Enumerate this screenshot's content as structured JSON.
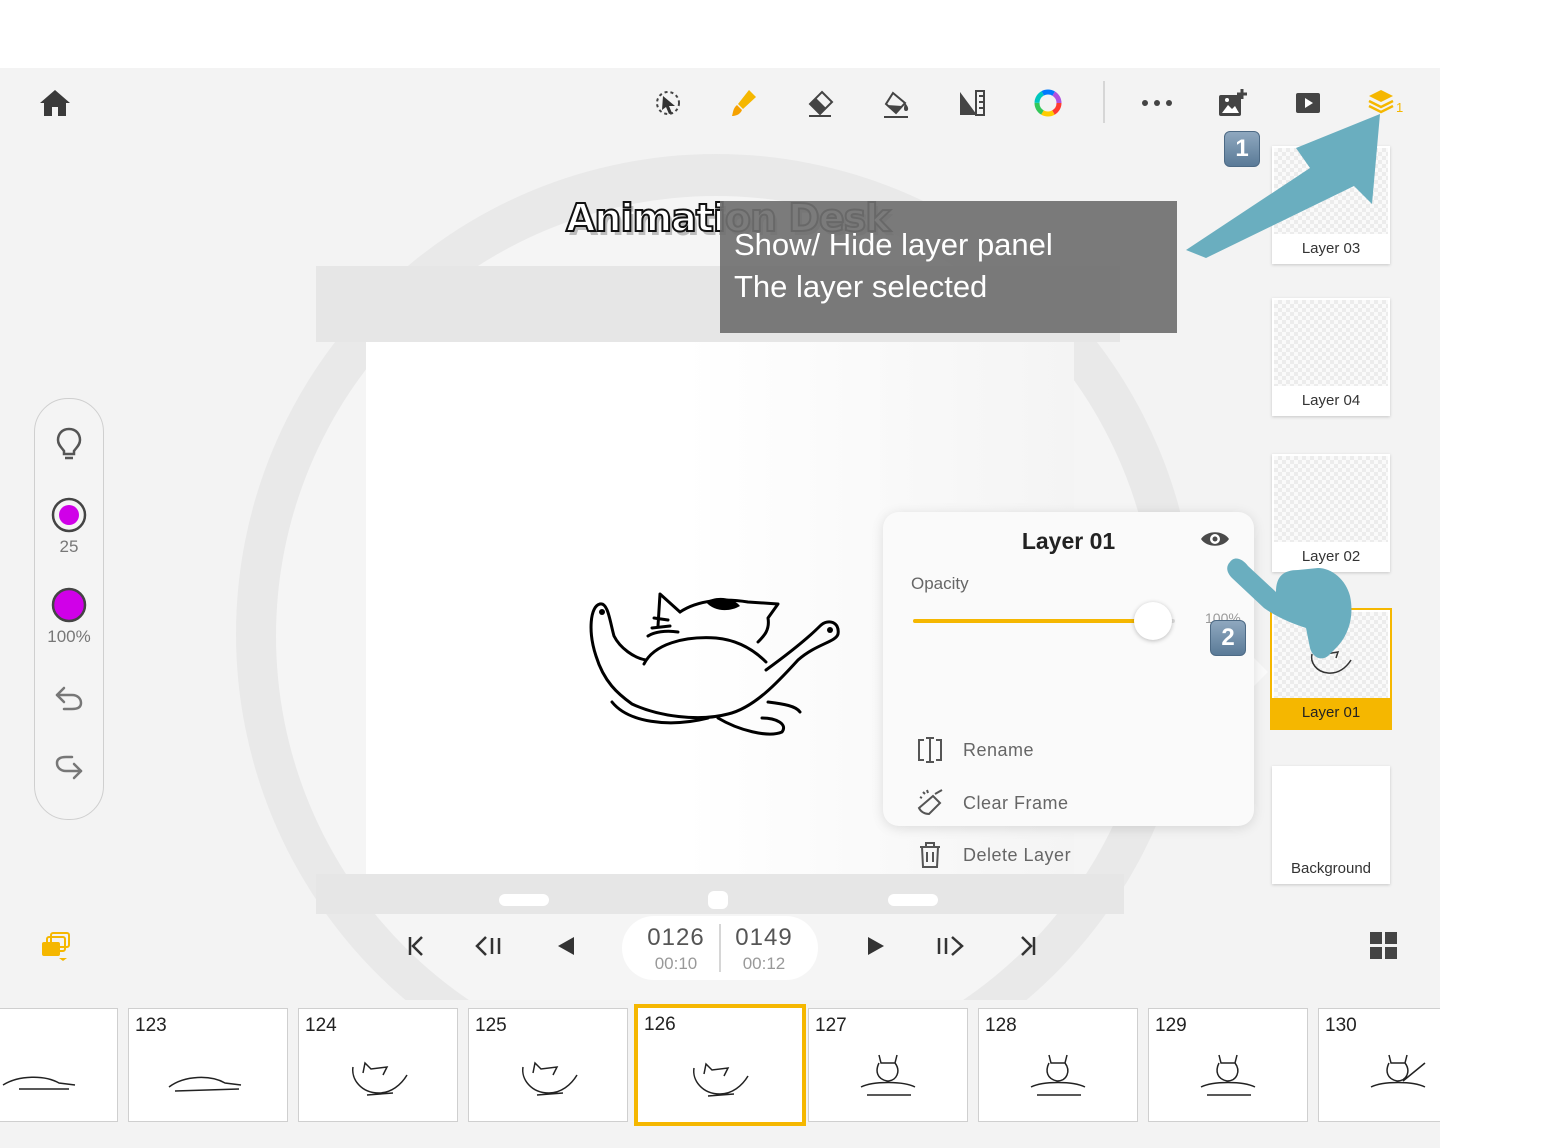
{
  "toolbar": {
    "tools": [
      "lasso-select-icon",
      "brush-icon",
      "eraser-icon",
      "paint-bucket-icon",
      "ruler-icon",
      "color-wheel-icon"
    ],
    "right": [
      "more-icon",
      "add-image-icon",
      "play-video-icon",
      "layers-icon"
    ],
    "layer_count_badge": "1"
  },
  "logo": {
    "text": "Animation Desk"
  },
  "left_tools": {
    "brush_size": "25",
    "opacity": "100%",
    "color": "#d000e8"
  },
  "tooltip": {
    "line1": "Show/ Hide layer panel",
    "line2": "The layer selected"
  },
  "badges": {
    "one": "1",
    "two": "2"
  },
  "layers": [
    {
      "name": "Layer 03",
      "selected": false
    },
    {
      "name": "Layer 04",
      "selected": false
    },
    {
      "name": "Layer 02",
      "selected": false
    },
    {
      "name": "Layer 01",
      "selected": true
    },
    {
      "name": "Background",
      "selected": false
    }
  ],
  "popover": {
    "title": "Layer 01",
    "opacity_label": "Opacity",
    "opacity_value_text": "100%",
    "opacity": 1.0,
    "items": [
      "Rename",
      "Clear Frame",
      "Delete Layer"
    ]
  },
  "transport": {
    "current_frame": "0126",
    "current_time": "00:10",
    "total_frames": "0149",
    "total_time": "00:12"
  },
  "frames": [
    "",
    "123",
    "124",
    "125",
    "126",
    "127",
    "128",
    "129",
    "130"
  ],
  "current_frame_index": 4,
  "colors": {
    "accent": "#f5b700",
    "arrow": "#6aaebf"
  }
}
